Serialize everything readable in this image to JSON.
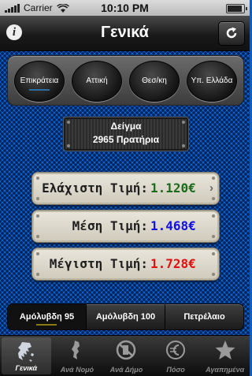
{
  "status": {
    "carrier": "Carrier",
    "time": "10:10 PM"
  },
  "nav": {
    "title": "Γενικά"
  },
  "regions": [
    {
      "label": "Επικράτεια",
      "selected": true
    },
    {
      "label": "Αττική",
      "selected": false
    },
    {
      "label": "Θεσ/κη",
      "selected": false
    },
    {
      "label": "Υπ. Ελλάδα",
      "selected": false
    }
  ],
  "sample": {
    "title": "Δείγμα",
    "subtitle": "2965 Πρατήρια"
  },
  "prices": [
    {
      "label": "Ελάχιστη Τιμή:",
      "value": "1.120€",
      "color": "#1a6b1a",
      "has_chevron": true
    },
    {
      "label": "Μέση Τιμή:",
      "value": "1.468€",
      "color": "#1010e0",
      "has_chevron": false
    },
    {
      "label": "Μέγιστη Τιμή:",
      "value": "1.728€",
      "color": "#e01010",
      "has_chevron": false
    }
  ],
  "fuels": [
    {
      "label": "Αμόλυβδη 95",
      "selected": true
    },
    {
      "label": "Αμόλυβδη 100",
      "selected": false
    },
    {
      "label": "Πετρέλαιο",
      "selected": false
    }
  ],
  "tabs": [
    {
      "label": "Γενικά",
      "icon": "greece-map-icon",
      "active": true
    },
    {
      "label": "Ανά Νομό",
      "icon": "region-map-icon",
      "active": false
    },
    {
      "label": "Ανά Δήμο",
      "icon": "municipality-icon",
      "active": false
    },
    {
      "label": "Πόσο",
      "icon": "euro-icon",
      "active": false
    },
    {
      "label": "Αγαπημένα",
      "icon": "star-icon",
      "active": false
    }
  ]
}
